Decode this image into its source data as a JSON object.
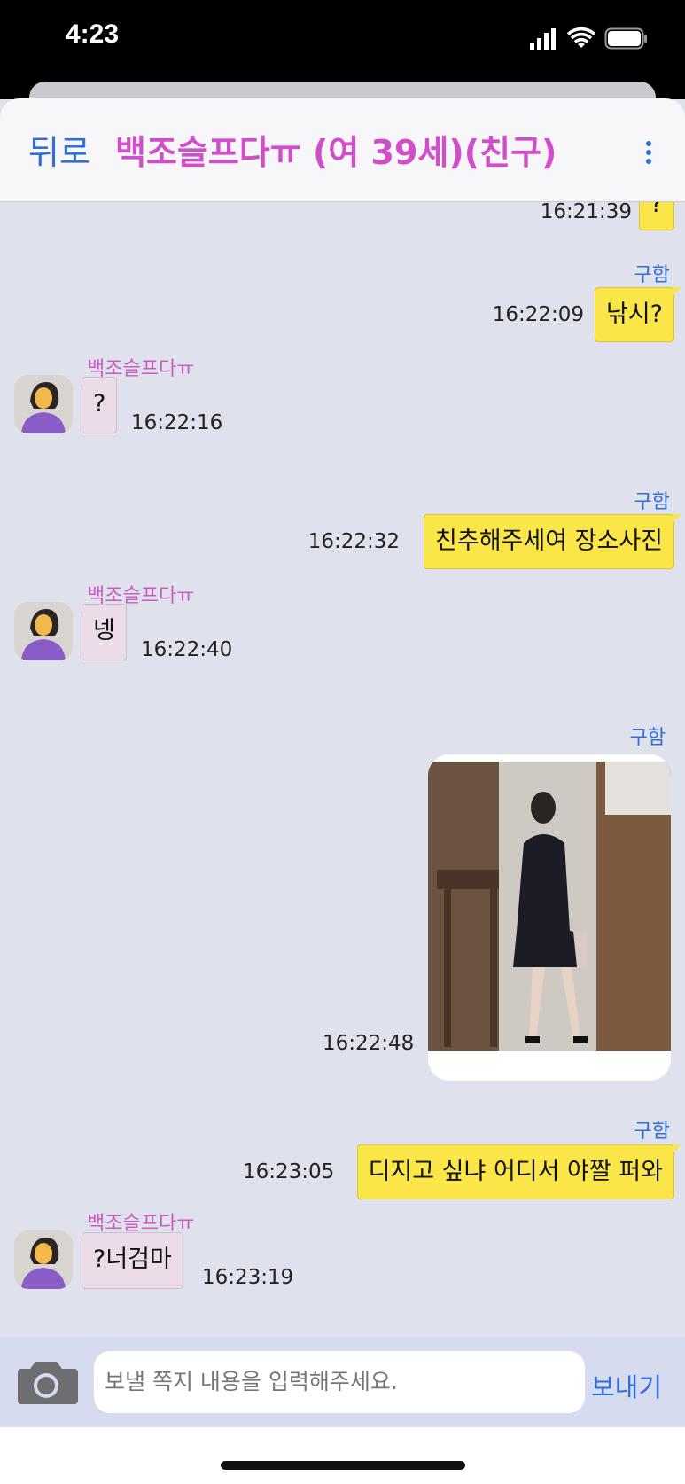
{
  "status": {
    "time": "4:23"
  },
  "header": {
    "back_label": "뒤로",
    "title": "백조슬프다ㅠ (여 39세)(친구)",
    "menu_icon": "vertical-ellipsis-icon"
  },
  "messages": [
    {
      "side": "out",
      "sender": "",
      "text": "?",
      "time": "16:21:39"
    },
    {
      "side": "out",
      "sender": "구함",
      "text": "낚시?",
      "time": "16:22:09"
    },
    {
      "side": "in",
      "sender": "백조슬프다ㅠ",
      "text": "?",
      "time": "16:22:16"
    },
    {
      "side": "out",
      "sender": "구함",
      "text": "친추해주세여 장소사진",
      "time": "16:22:32"
    },
    {
      "side": "in",
      "sender": "백조슬프다ㅠ",
      "text": "넹",
      "time": "16:22:40"
    },
    {
      "side": "out",
      "sender": "구함",
      "type": "image",
      "time": "16:22:48"
    },
    {
      "side": "out",
      "sender": "구함",
      "text": "디지고 싶냐 어디서 야짤 퍼와",
      "time": "16:23:05"
    },
    {
      "side": "in",
      "sender": "백조슬프다ㅠ",
      "text": "?너검마",
      "time": "16:23:19"
    }
  ],
  "composer": {
    "placeholder": "보낼 쪽지 내용을 입력해주세요.",
    "send_label": "보내기",
    "camera_icon": "camera-icon"
  },
  "colors": {
    "accent": "#2f6fd6",
    "title": "#d04fc8",
    "bubble_out": "#fbe64a",
    "bubble_in": "#ecdbe9",
    "chat_bg": "#dfe1ec"
  }
}
